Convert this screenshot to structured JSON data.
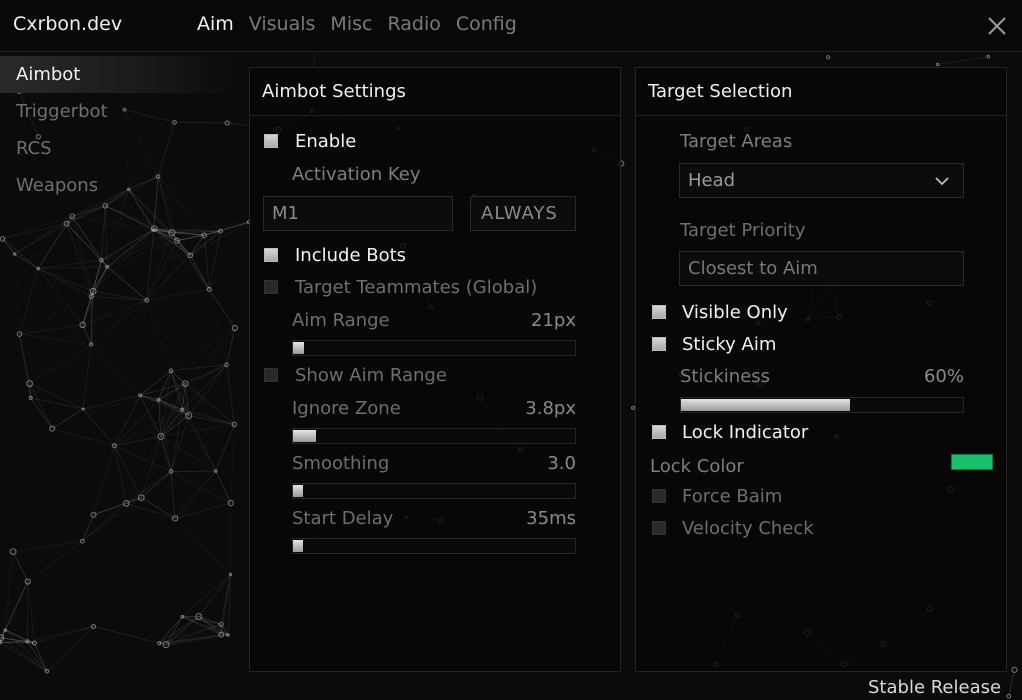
{
  "app": {
    "title": "Cxrbon.dev",
    "footer": "Stable Release"
  },
  "tabs": [
    {
      "label": "Aim",
      "active": true
    },
    {
      "label": "Visuals",
      "active": false
    },
    {
      "label": "Misc",
      "active": false
    },
    {
      "label": "Radio",
      "active": false
    },
    {
      "label": "Config",
      "active": false
    }
  ],
  "sidebar": {
    "items": [
      {
        "label": "Aimbot",
        "active": true
      },
      {
        "label": "Triggerbot",
        "active": false
      },
      {
        "label": "RCS",
        "active": false
      },
      {
        "label": "Weapons",
        "active": false
      }
    ]
  },
  "aimbot": {
    "title": "Aimbot Settings",
    "enable": {
      "label": "Enable",
      "checked": true
    },
    "activation_key": {
      "label": "Activation Key",
      "key": "M1",
      "mode": "ALWAYS"
    },
    "include_bots": {
      "label": "Include Bots",
      "checked": true
    },
    "target_teammates": {
      "label": "Target Teammates (Global)",
      "checked": false
    },
    "aim_range": {
      "label": "Aim Range",
      "value": "21px",
      "fill": 0.04
    },
    "show_aim_range": {
      "label": "Show Aim Range",
      "checked": false
    },
    "ignore_zone": {
      "label": "Ignore Zone",
      "value": "3.8px",
      "fill": 0.08
    },
    "smoothing": {
      "label": "Smoothing",
      "value": "3.0",
      "fill": 0.02
    },
    "start_delay": {
      "label": "Start Delay",
      "value": "35ms",
      "fill": 0.035
    }
  },
  "target": {
    "title": "Target Selection",
    "areas": {
      "label": "Target Areas",
      "value": "Head"
    },
    "priority": {
      "label": "Target Priority",
      "value": "Closest to Aim"
    },
    "visible_only": {
      "label": "Visible Only",
      "checked": true
    },
    "sticky_aim": {
      "label": "Sticky Aim",
      "checked": true
    },
    "stickiness": {
      "label": "Stickiness",
      "value": "60%",
      "fill": 0.6
    },
    "lock_indicator": {
      "label": "Lock Indicator",
      "checked": true
    },
    "lock_color": {
      "label": "Lock Color",
      "color": "#18c06a"
    },
    "force_baim": {
      "label": "Force Baim",
      "checked": false
    },
    "velocity_check": {
      "label": "Velocity Check",
      "checked": false
    }
  },
  "icons": {
    "close": "close-icon",
    "dropdown": "chevron-down-icon"
  }
}
